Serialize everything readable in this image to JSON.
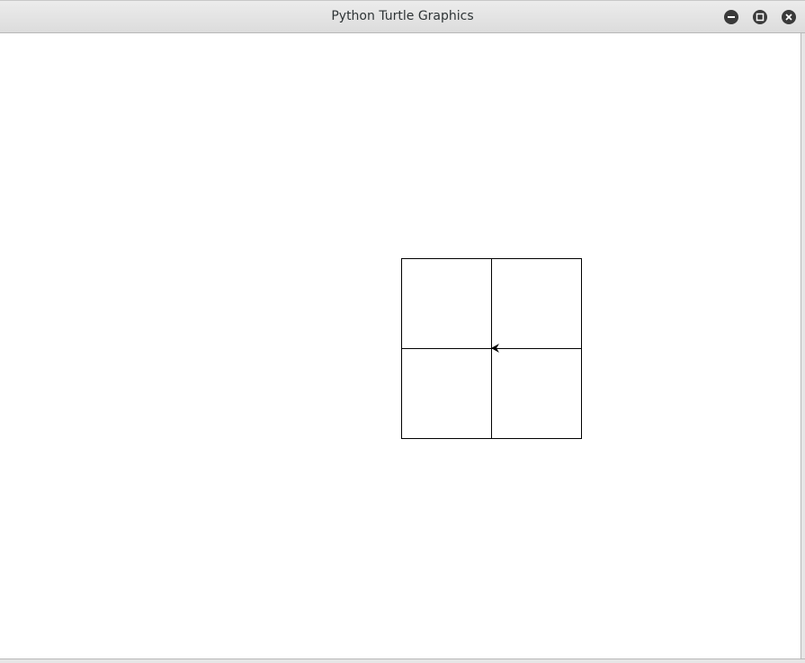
{
  "window": {
    "title": "Python Turtle Graphics"
  },
  "controls": {
    "minimize_icon": "minimize-icon",
    "maximize_icon": "maximize-icon",
    "close_icon": "close-icon"
  },
  "canvas": {
    "background": "#ffffff",
    "stroke_color": "#000000",
    "turtle_heading": "west"
  }
}
